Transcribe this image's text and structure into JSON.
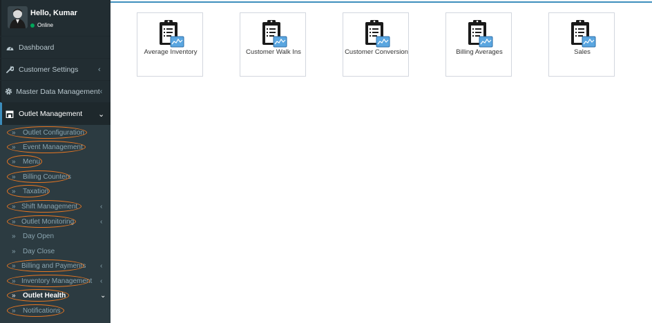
{
  "user": {
    "greeting": "Hello, Kumar",
    "status": "Online"
  },
  "menu": {
    "dashboard": "Dashboard",
    "customer_settings": "Customer Settings",
    "master_data": "Master Data Management",
    "outlet_management": "Outlet Management"
  },
  "submenu": [
    {
      "label": "Outlet Configuration"
    },
    {
      "label": "Event Management"
    },
    {
      "label": "Menu"
    },
    {
      "label": "Billing Counters"
    },
    {
      "label": "Taxation"
    },
    {
      "label": "Shift Management"
    },
    {
      "label": "Outlet Monitoring"
    },
    {
      "label": "Day Open"
    },
    {
      "label": "Day Close"
    },
    {
      "label": "Billing and Payments"
    },
    {
      "label": "Inventory Management"
    },
    {
      "label": "Outlet Health"
    },
    {
      "label": "Notifications"
    }
  ],
  "tiles": [
    {
      "label": "Average Inventory"
    },
    {
      "label": "Customer Walk Ins"
    },
    {
      "label": "Customer Conversion"
    },
    {
      "label": "Billing Averages"
    },
    {
      "label": "Sales"
    }
  ],
  "colors": {
    "sidebar": "#222d32",
    "submenu": "#2c3b41",
    "accent": "#3c8dbc",
    "highlight_oval": "#e87722",
    "online": "#00a65a"
  }
}
